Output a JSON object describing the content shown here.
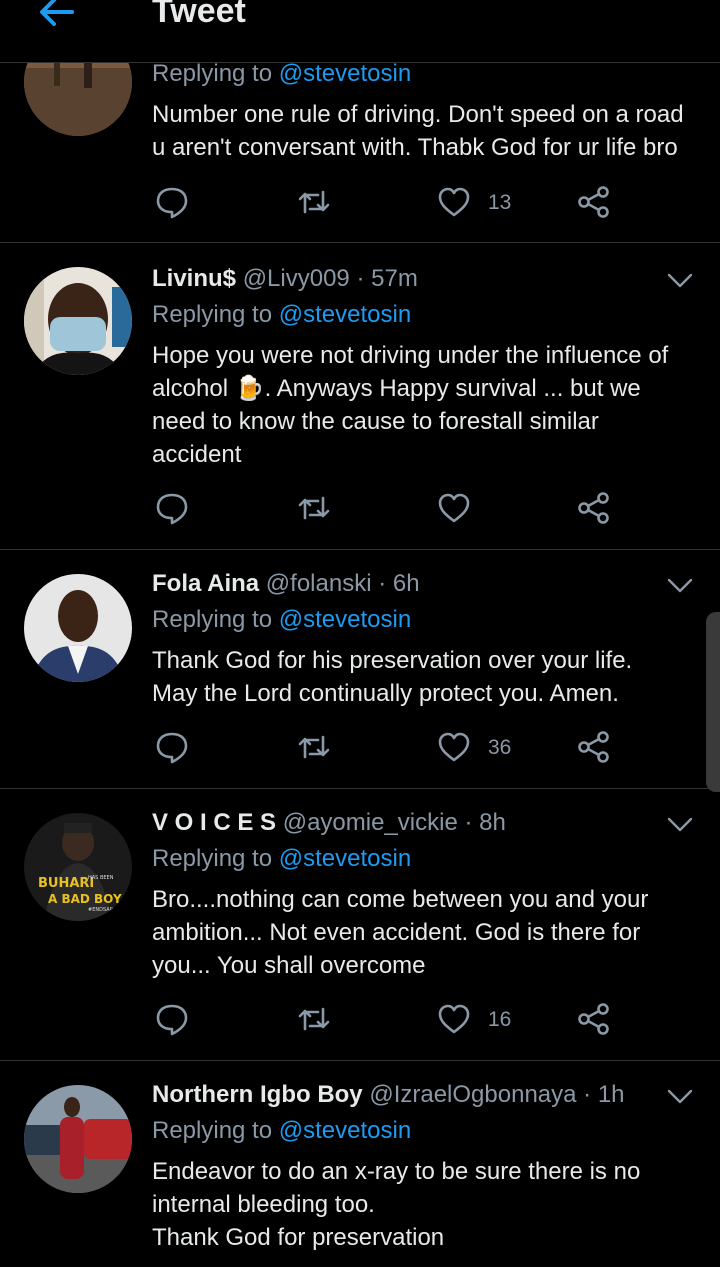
{
  "header": {
    "title": "Tweet",
    "back_icon": "arrow-left-icon",
    "accent": "#1d9bf0"
  },
  "tweets": [
    {
      "name": "",
      "handle": "",
      "time": "",
      "replying_prefix": "Replying to",
      "mention": "@stevetosin",
      "lines": [
        "Number one rule of driving. Don't speed on a road",
        "u aren't conversant with. Thabk God for ur life bro"
      ],
      "likes": "13"
    },
    {
      "name": "Livinu$",
      "handle": "@Livy009",
      "sep": "·",
      "time": "57m",
      "replying_prefix": "Replying to",
      "mention": "@stevetosin",
      "lines": [
        "Hope you were not driving under the influence of",
        "alcohol 🍺. Anyways Happy survival ... but we",
        "need to know the cause to forestall similar",
        "accident"
      ],
      "likes": ""
    },
    {
      "name": "Fola Aina",
      "handle": "@folanski",
      "sep": "·",
      "time": "6h",
      "replying_prefix": "Replying to",
      "mention": "@stevetosin",
      "lines": [
        "Thank God for his preservation over your life.",
        "May the Lord continually protect you. Amen."
      ],
      "likes": "36"
    },
    {
      "name": "V O I C E S",
      "handle": "@ayomie_vickie",
      "sep": "·",
      "time": "8h",
      "replying_prefix": "Replying to",
      "mention": "@stevetosin",
      "lines": [
        "Bro....nothing can come between you and your",
        "ambition... Not even accident. God is there for",
        "you... You shall overcome"
      ],
      "likes": "16",
      "avatar_text": {
        "line1": "BUHARI",
        "line2": "A BAD BOY",
        "small": "HAS BEEN",
        "tag": "#ENDSARS"
      }
    },
    {
      "name": "Northern Igbo Boy",
      "handle": "@IzraelOgbonnaya",
      "sep": "·",
      "time": "1h",
      "replying_prefix": "Replying to",
      "mention": "@stevetosin",
      "lines": [
        "Endeavor to do an x-ray to be sure there is no",
        "internal bleeding too.",
        "Thank God for preservation"
      ],
      "likes": ""
    }
  ]
}
